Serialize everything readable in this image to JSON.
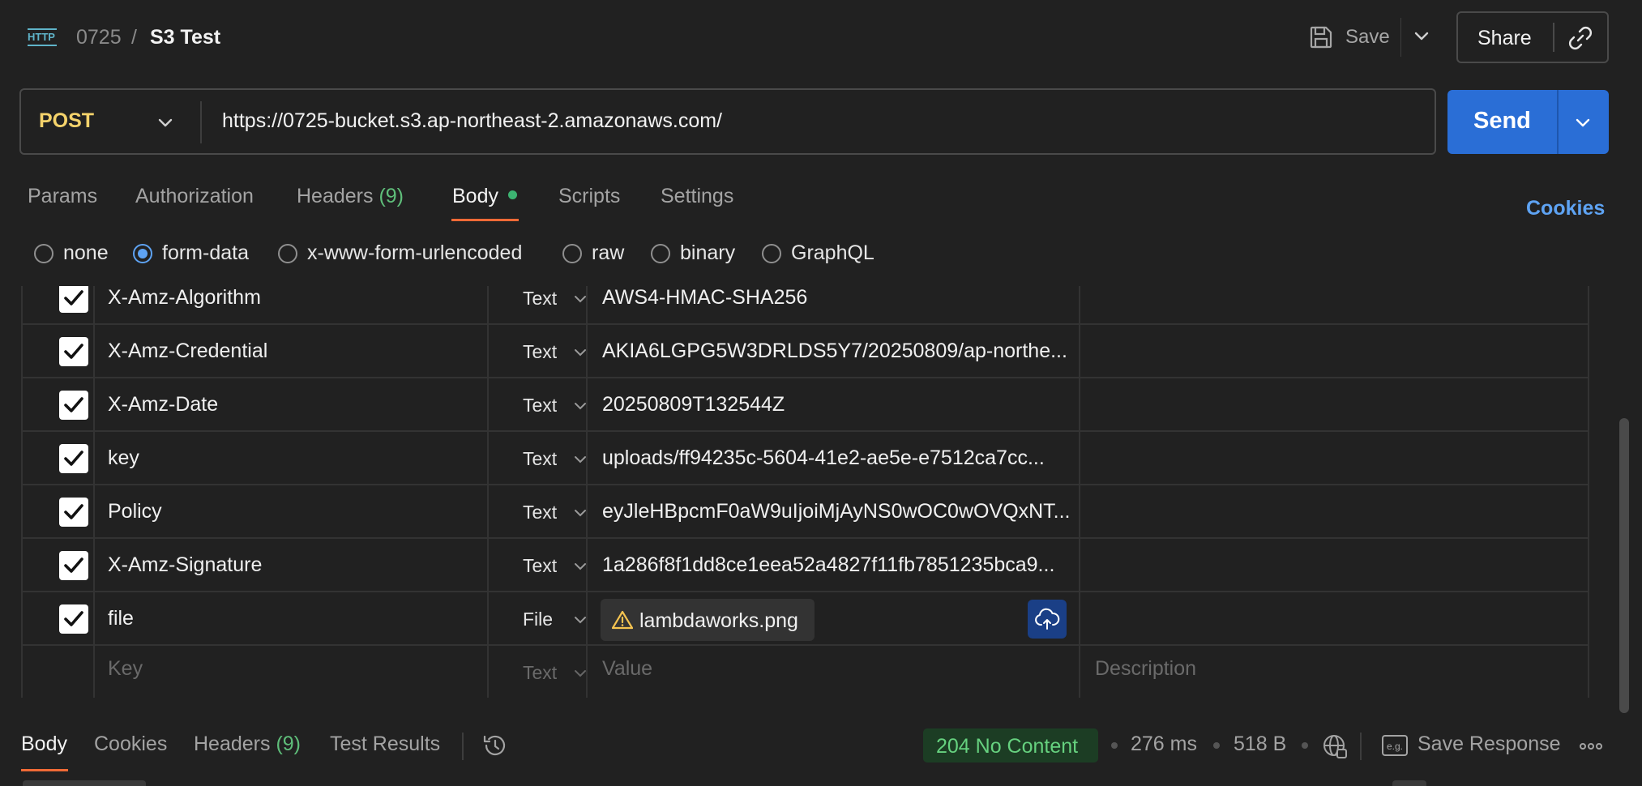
{
  "breadcrumb": {
    "collection": "0725",
    "separator": "/",
    "request_name": "S3 Test"
  },
  "header": {
    "save_label": "Save",
    "share_label": "Share"
  },
  "request": {
    "method": "POST",
    "url": "https://0725-bucket.s3.ap-northeast-2.amazonaws.com/",
    "send_label": "Send"
  },
  "tabs": [
    {
      "label": "Params"
    },
    {
      "label": "Authorization"
    },
    {
      "label": "Headers",
      "count": "(9)"
    },
    {
      "label": "Body",
      "active": true
    },
    {
      "label": "Scripts"
    },
    {
      "label": "Settings"
    }
  ],
  "cookies_link": "Cookies",
  "body_types": [
    {
      "label": "none",
      "checked": false
    },
    {
      "label": "form-data",
      "checked": true
    },
    {
      "label": "x-www-form-urlencoded",
      "checked": false
    },
    {
      "label": "raw",
      "checked": false
    },
    {
      "label": "binary",
      "checked": false
    },
    {
      "label": "GraphQL",
      "checked": false
    }
  ],
  "form_rows": [
    {
      "checked": true,
      "key": "X-Amz-Algorithm",
      "type": "Text",
      "value": "AWS4-HMAC-SHA256"
    },
    {
      "checked": true,
      "key": "X-Amz-Credential",
      "type": "Text",
      "value": "AKIA6LGPG5W3DRLDS5Y7/20250809/ap-northe..."
    },
    {
      "checked": true,
      "key": "X-Amz-Date",
      "type": "Text",
      "value": "20250809T132544Z"
    },
    {
      "checked": true,
      "key": "key",
      "type": "Text",
      "value": "uploads/ff94235c-5604-41e2-ae5e-e7512ca7cc..."
    },
    {
      "checked": true,
      "key": "Policy",
      "type": "Text",
      "value": "eyJleHBpcmF0aW9uIjoiMjAyNS0wOC0wOVQxNT..."
    },
    {
      "checked": true,
      "key": "X-Amz-Signature",
      "type": "Text",
      "value": "1a286f8f1dd8ce1eea52a4827f11fb7851235bca9..."
    },
    {
      "checked": true,
      "key": "file",
      "type": "File",
      "value": "lambdaworks.png"
    }
  ],
  "empty_row": {
    "key_placeholder": "Key",
    "type": "Text",
    "value_placeholder": "Value",
    "description_placeholder": "Description"
  },
  "response": {
    "tabs": [
      {
        "label": "Body",
        "active": true
      },
      {
        "label": "Cookies"
      },
      {
        "label": "Headers",
        "count": "(9)"
      },
      {
        "label": "Test Results"
      }
    ],
    "status": "204 No Content",
    "time": "276 ms",
    "size": "518 B",
    "save_response_label": "Save Response"
  },
  "colors": {
    "accent_blue": "#2a6ed6",
    "method_yellow": "#f5d36b",
    "tab_underline": "#ef6a36",
    "success_green": "#66d17f"
  },
  "icons": [
    "http-icon",
    "save-icon",
    "chevron-down-icon",
    "link-icon",
    "checkbox-checked-icon",
    "warning-icon",
    "cloud-upload-icon",
    "history-icon",
    "globe-icon",
    "example-icon",
    "more-icon"
  ]
}
